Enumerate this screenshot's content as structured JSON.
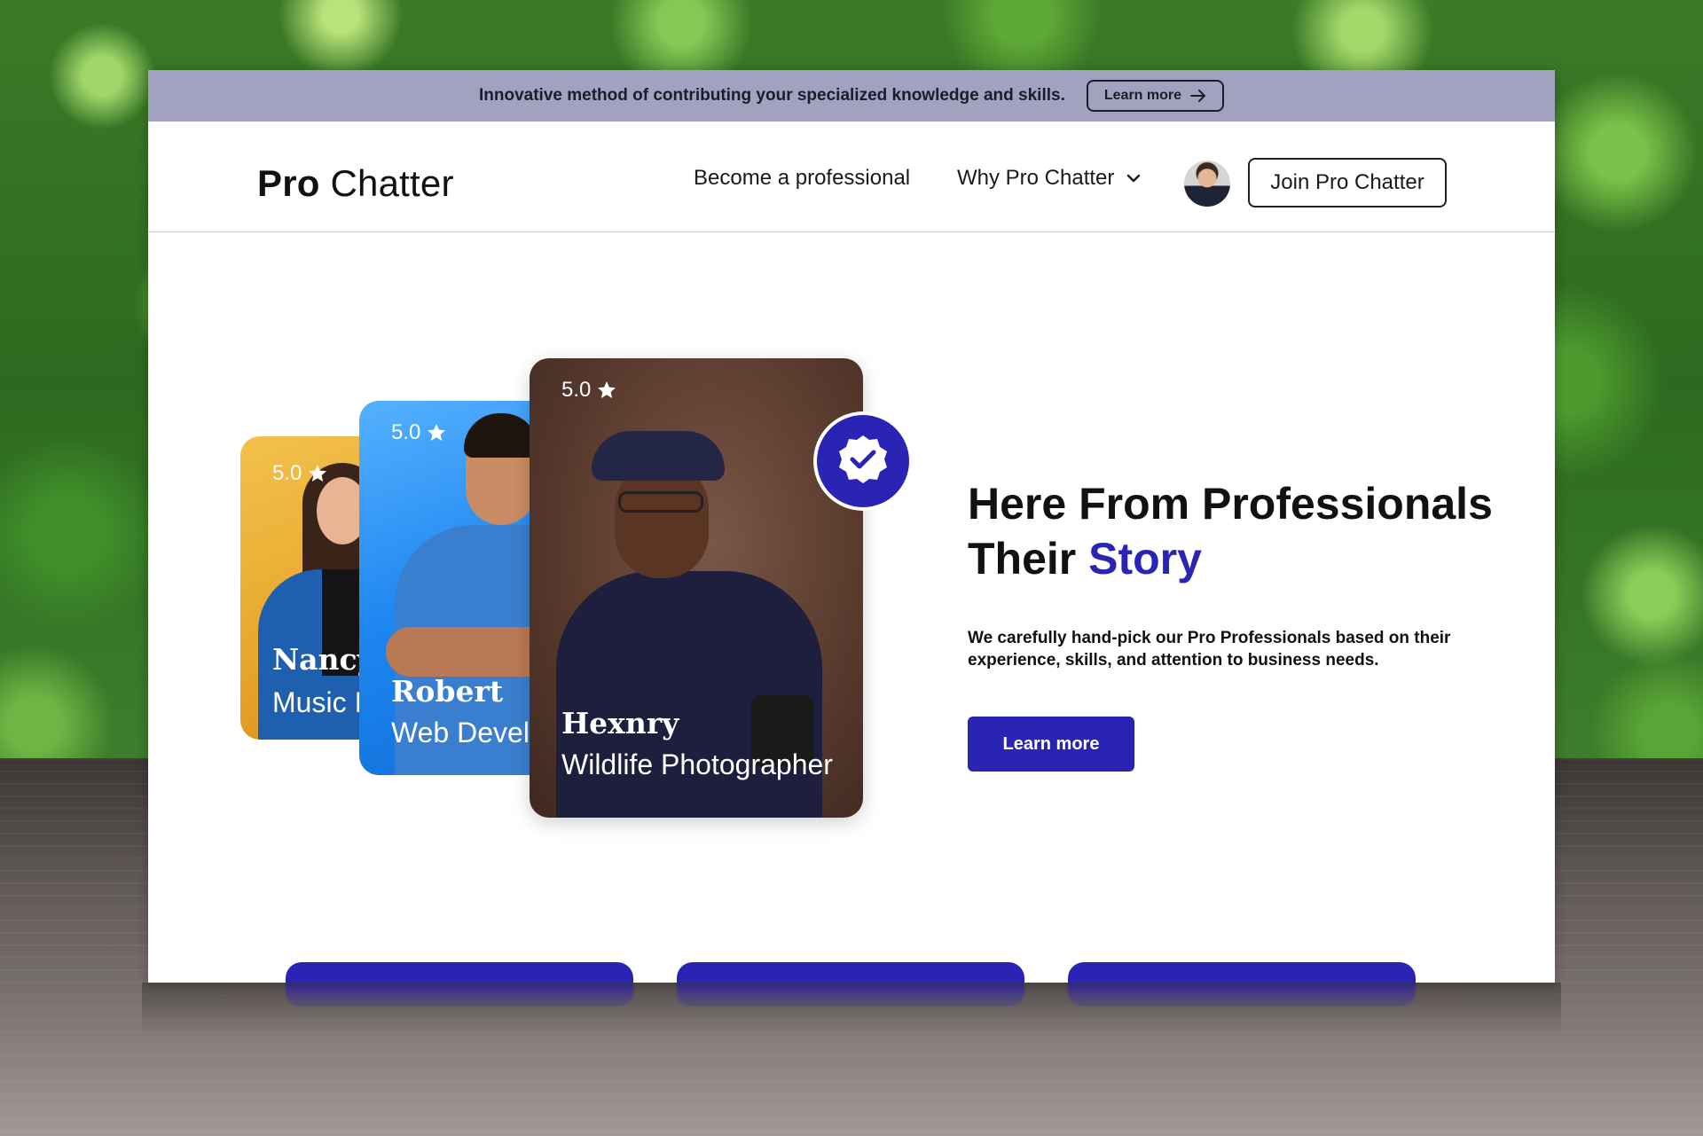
{
  "announcement": {
    "text": "Innovative method of contributing your specialized knowledge and skills.",
    "button_label": "Learn more"
  },
  "navbar": {
    "logo_strong": "Pro",
    "logo_rest": " Chatter",
    "links": [
      {
        "label": "Become a professional"
      },
      {
        "label": "Why Pro Chatter",
        "icon": "chevron-down-icon"
      }
    ],
    "join_label": "Join Pro Chatter"
  },
  "cards": [
    {
      "rating": "5.0",
      "name": "Nancy",
      "role": "Music I"
    },
    {
      "rating": "5.0",
      "name": "Robert",
      "role": "Web Devel"
    },
    {
      "rating": "5.0",
      "name": "Hexnry",
      "role": "Wildlife Photographer"
    }
  ],
  "hero": {
    "heading_line1": "Here From Professionals",
    "heading_line2_plain": "Their ",
    "heading_line2_accent": "Story",
    "paragraph": "We carefully hand-pick our Pro Professionals based on their experience, skills, and attention to business needs.",
    "button_label": "Learn more"
  },
  "colors": {
    "accent": "#2a24b5",
    "announcement_bg": "#a3a1c0"
  }
}
